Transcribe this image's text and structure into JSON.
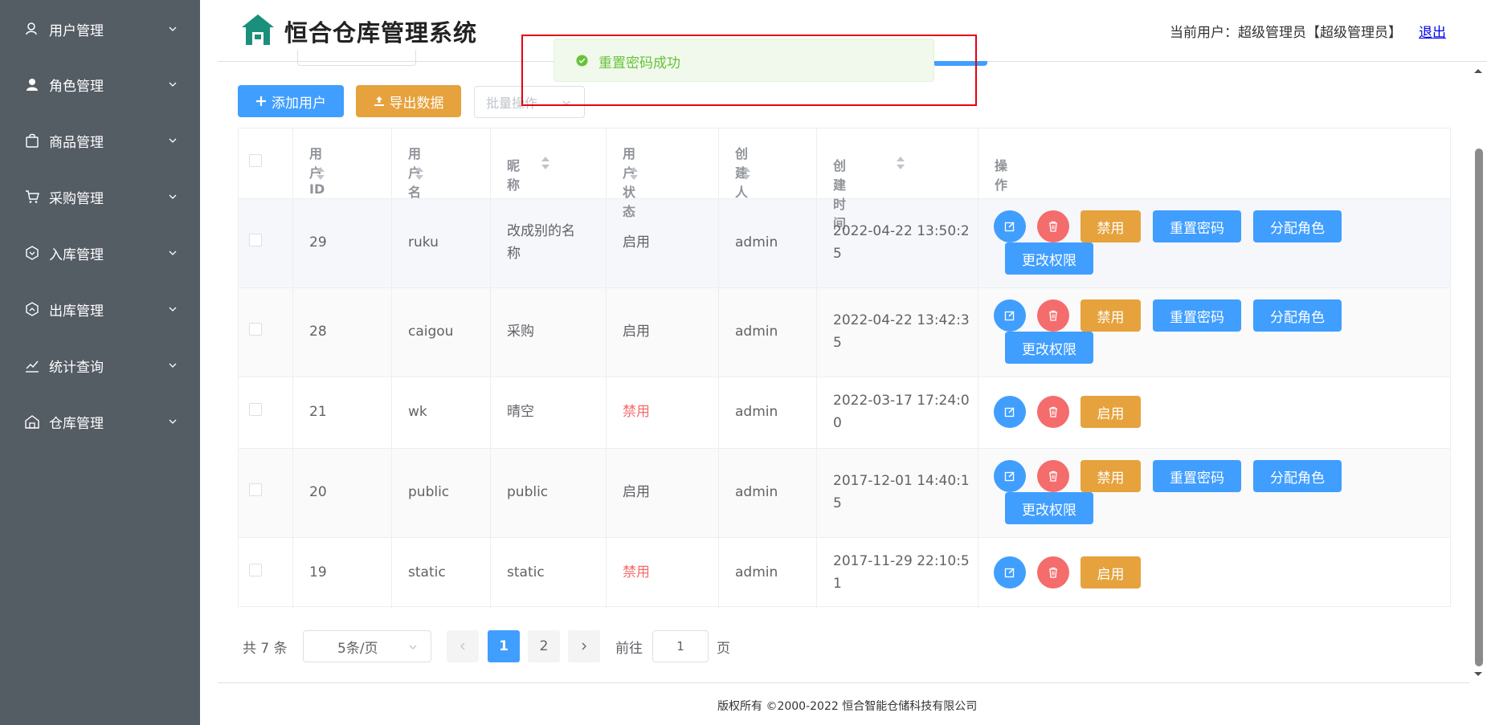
{
  "app": {
    "title": "恒合仓库管理系统",
    "current_user_label": "当前用户：超级管理员【超级管理员】",
    "logout_label": "退出"
  },
  "sidebar": {
    "items": [
      {
        "label": "用户管理",
        "icon": "user-icon"
      },
      {
        "label": "角色管理",
        "icon": "role-icon"
      },
      {
        "label": "商品管理",
        "icon": "goods-icon"
      },
      {
        "label": "采购管理",
        "icon": "cart-icon"
      },
      {
        "label": "入库管理",
        "icon": "inbound-icon"
      },
      {
        "label": "出库管理",
        "icon": "outbound-icon"
      },
      {
        "label": "统计查询",
        "icon": "stats-icon"
      },
      {
        "label": "仓库管理",
        "icon": "warehouse-icon"
      }
    ]
  },
  "toolbar": {
    "add_label": "添加用户",
    "export_label": "导出数据",
    "batch_placeholder": "批量操作"
  },
  "table": {
    "headers": {
      "id": "用户ID",
      "username": "用户名",
      "nickname": "昵称",
      "status": "用户状态",
      "creator": "创建人",
      "created_time": "创建时间",
      "actions": "操作"
    },
    "rows": [
      {
        "id": "29",
        "username": "ruku",
        "nickname_l1": "改成别的名",
        "nickname_l2": "称",
        "status": "启用",
        "creator": "admin",
        "time_l1": "2022-04-22 13:50:2",
        "time_l2": "5",
        "toggle_label": "禁用",
        "reset_label": "重置密码",
        "assign_label": "分配角色",
        "perm_label": "更改权限"
      },
      {
        "id": "28",
        "username": "caigou",
        "nickname_l1": "采购",
        "nickname_l2": "",
        "status": "启用",
        "creator": "admin",
        "time_l1": "2022-04-22 13:42:3",
        "time_l2": "5",
        "toggle_label": "禁用",
        "reset_label": "重置密码",
        "assign_label": "分配角色",
        "perm_label": "更改权限"
      },
      {
        "id": "21",
        "username": "wk",
        "nickname_l1": "晴空",
        "nickname_l2": "",
        "status": "禁用",
        "creator": "admin",
        "time_l1": "2022-03-17 17:24:0",
        "time_l2": "0",
        "toggle_label": "启用"
      },
      {
        "id": "20",
        "username": "public",
        "nickname_l1": "public",
        "nickname_l2": "",
        "status": "启用",
        "creator": "admin",
        "time_l1": "2017-12-01 14:40:1",
        "time_l2": "5",
        "toggle_label": "禁用",
        "reset_label": "重置密码",
        "assign_label": "分配角色",
        "perm_label": "更改权限"
      },
      {
        "id": "19",
        "username": "static",
        "nickname_l1": "static",
        "nickname_l2": "",
        "status": "禁用",
        "creator": "admin",
        "time_l1": "2017-11-29 22:10:5",
        "time_l2": "1",
        "toggle_label": "启用"
      }
    ]
  },
  "pagination": {
    "total_label": "共 7 条",
    "page_size_label": "5条/页",
    "pages": [
      "1",
      "2"
    ],
    "current_page": "1",
    "goto_label": "前往",
    "goto_value": "1",
    "page_unit": "页"
  },
  "message": {
    "text": "重置密码成功",
    "type": "success"
  },
  "footer": {
    "copyright": "版权所有 ©2000-2022  恒合智能仓储科技有限公司"
  },
  "colors": {
    "sidebar_bg": "#545c64",
    "primary": "#409eff",
    "warning": "#e6a23c",
    "danger": "#f56c6c",
    "success": "#67c23a",
    "logo": "#1a8f7a"
  }
}
